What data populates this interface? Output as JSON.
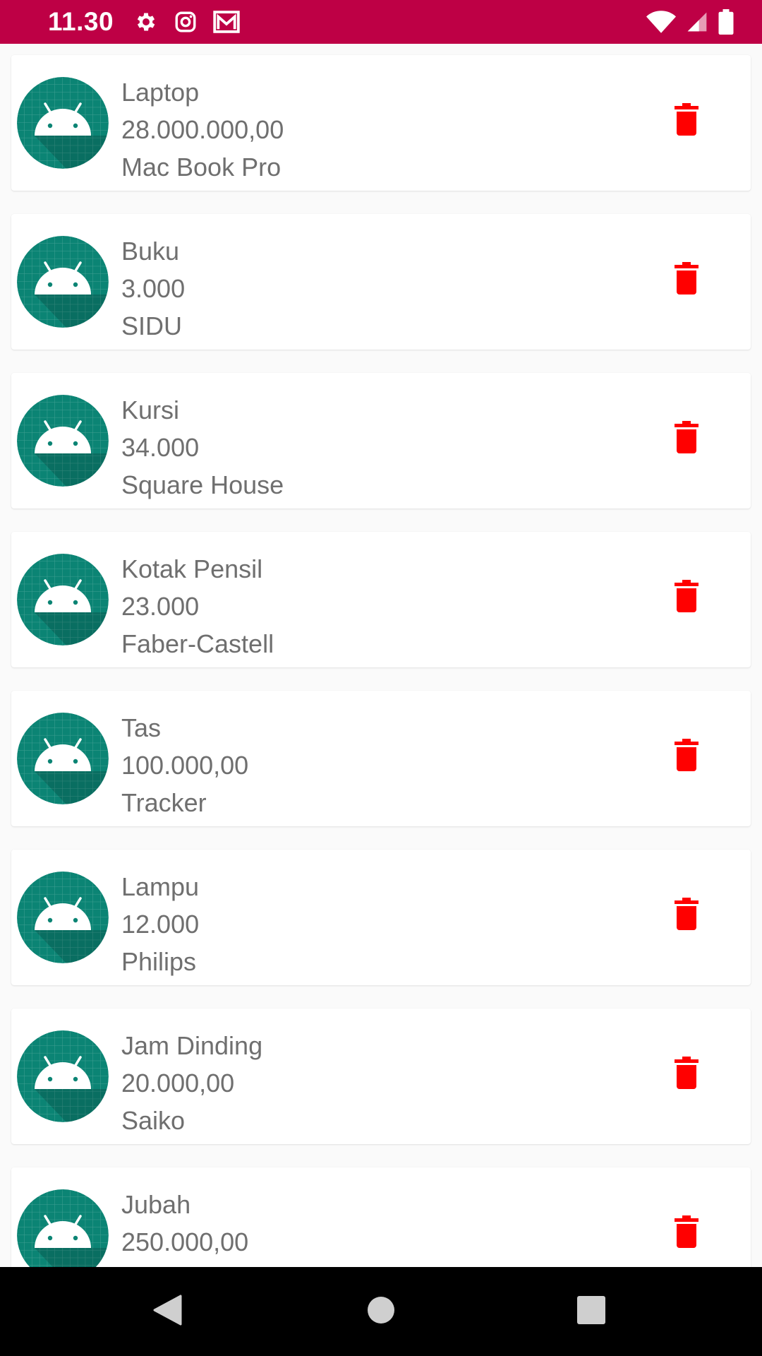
{
  "status_bar": {
    "time": "11.30",
    "left_icons": [
      "gear-icon",
      "instagram-icon",
      "gmail-icon"
    ],
    "right_icons": [
      "wifi-icon",
      "cell-signal-icon",
      "battery-icon"
    ],
    "color": "#BE0045"
  },
  "items": [
    {
      "name": "Laptop",
      "price": "28.000.000,00",
      "brand": "Mac Book Pro"
    },
    {
      "name": "Buku",
      "price": "3.000",
      "brand": "SIDU"
    },
    {
      "name": "Kursi",
      "price": "34.000",
      "brand": "Square House"
    },
    {
      "name": "Kotak Pensil",
      "price": "23.000",
      "brand": "Faber-Castell"
    },
    {
      "name": "Tas",
      "price": "100.000,00",
      "brand": "Tracker"
    },
    {
      "name": "Lampu",
      "price": "12.000",
      "brand": "Philips"
    },
    {
      "name": "Jam Dinding",
      "price": "20.000,00",
      "brand": "Saiko"
    },
    {
      "name": "Jubah",
      "price": "250.000,00",
      "brand": ""
    }
  ],
  "icons": {
    "avatar": "android-icon",
    "delete": "trash-icon"
  },
  "colors": {
    "avatar_bg": "#0B8474",
    "delete": "#FF0000",
    "text": "#6F6F6F"
  },
  "nav_bar": {
    "buttons": [
      "back-icon",
      "home-icon",
      "recents-icon"
    ]
  }
}
